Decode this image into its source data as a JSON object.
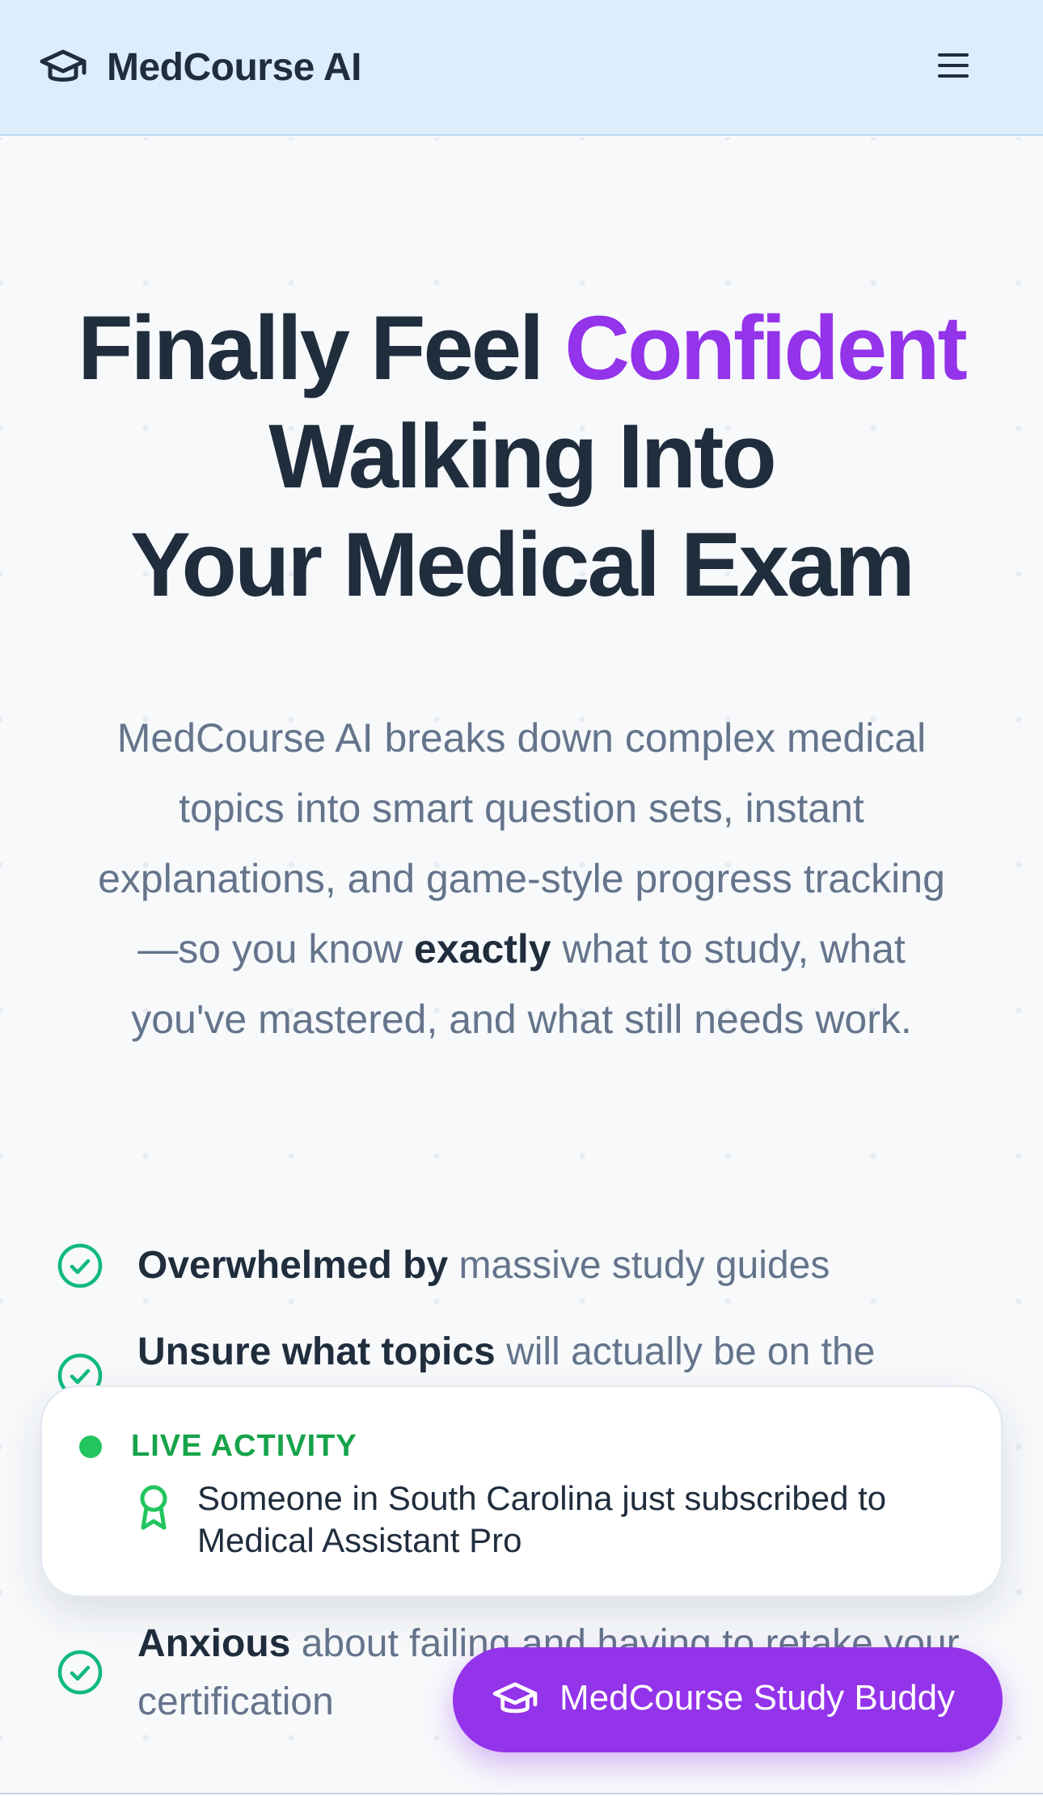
{
  "header": {
    "brand": "MedCourse AI",
    "logo_icon": "graduation-cap-icon",
    "menu_icon": "hamburger-menu-icon"
  },
  "hero": {
    "title_part1": "Finally Feel ",
    "title_accent": "Confident",
    "title_line2": "Walking Into",
    "title_line3": "Your Medical Exam",
    "desc_before": "MedCourse AI breaks down complex medical topics into smart question sets, instant explanations, and game-style progress tracking—so you know ",
    "desc_bold": "exactly",
    "desc_after": " what to study, what you've mastered, and what still needs work."
  },
  "pain_points": [
    {
      "bold": "Overwhelmed by",
      "rest": " massive study guides"
    },
    {
      "bold": "Unsure what topics",
      "rest": " will actually be on the"
    },
    {
      "bold": "Anxious",
      "rest": " about failing and having to retake your certification"
    }
  ],
  "live_activity": {
    "label": "LIVE ACTIVITY",
    "message": "Someone in South Carolina just subscribed to Medical Assistant Pro",
    "icon": "award-ribbon-icon"
  },
  "study_buddy": {
    "label": "MedCourse Study Buddy",
    "icon": "graduation-cap-icon"
  },
  "colors": {
    "accent": "#9333ea",
    "header_bg": "#dcedfb",
    "live_green": "#16a34a",
    "check_green": "#10b981"
  }
}
